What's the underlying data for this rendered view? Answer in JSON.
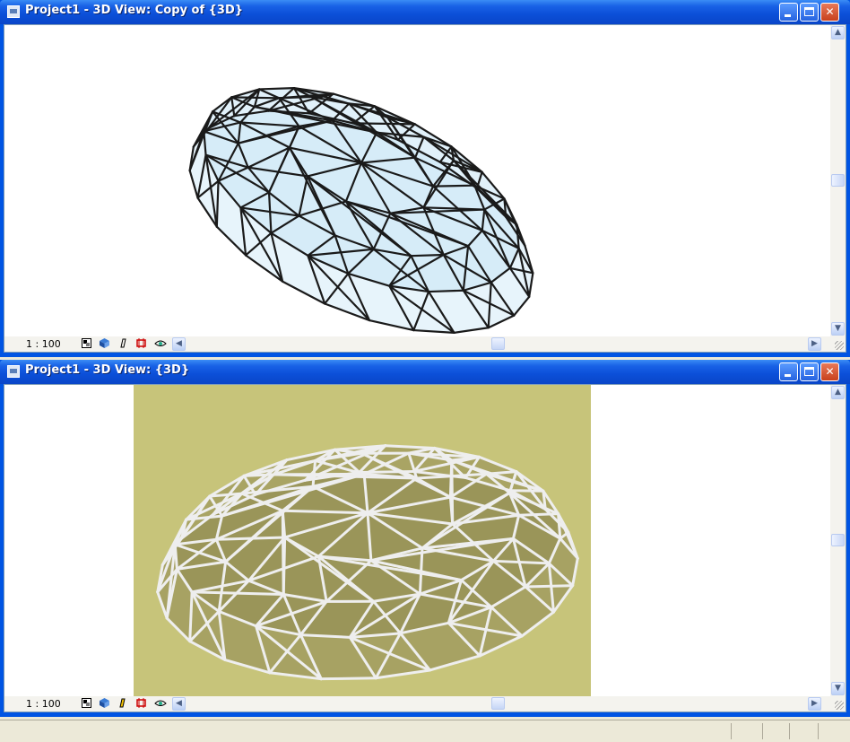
{
  "windows": [
    {
      "title": "Project1 - 3D View: Copy of {3D}",
      "view_style": "shaded-glass",
      "scale_label": "1 : 100",
      "background": "#ffffff",
      "glass_color": "#e4f3fb",
      "frame_color": "#1a1a1a"
    },
    {
      "title": "Project1 - 3D View: {3D}",
      "view_style": "realistic",
      "scale_label": "1 : 100",
      "background": "#c7c47a",
      "glass_color": "#a39e60",
      "frame_color": "#eeeeee"
    }
  ],
  "icons": {
    "minimize": "minimize-icon",
    "maximize": "maximize-icon",
    "close": "close-icon",
    "scroll_up": "scroll-up-icon",
    "scroll_down": "scroll-down-icon",
    "scroll_left": "scroll-left-icon",
    "scroll_right": "scroll-right-icon"
  },
  "colors": {
    "titlebar": "#0a4fd8",
    "window_frame": "#0054e3",
    "status_bar": "#ece9d8"
  }
}
